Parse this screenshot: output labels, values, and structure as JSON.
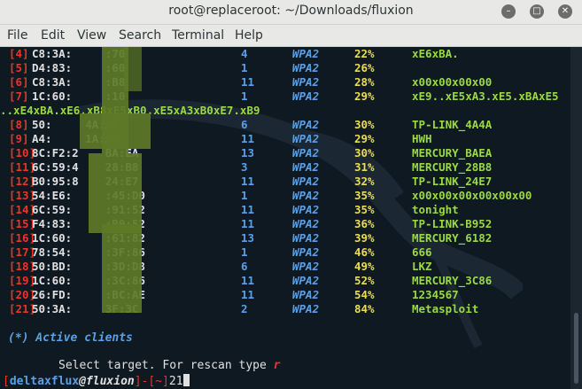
{
  "window": {
    "title": "root@replaceroot: ~/Downloads/fluxion",
    "buttons": [
      "minimize",
      "maximize",
      "close"
    ]
  },
  "menu": [
    "File",
    "Edit",
    "View",
    "Search",
    "Terminal",
    "Help"
  ],
  "networks": [
    {
      "idx": "4",
      "bssid": "C8:3A:     :70",
      "ch": "4",
      "enc": "WPA2",
      "pwr": "22%",
      "essid": "xE6xBA."
    },
    {
      "idx": "5",
      "bssid": "D4:83:     :60",
      "ch": "1",
      "enc": "WPA2",
      "pwr": "26%",
      "essid": ""
    },
    {
      "idx": "6",
      "bssid": "C8:3A:     :B8",
      "ch": "11",
      "enc": "WPA2",
      "pwr": "28%",
      "essid": "x00x00x00x00"
    },
    {
      "idx": "7",
      "bssid": "1C:60:     :10",
      "ch": "1",
      "enc": "WPA2",
      "pwr": "29%",
      "essid": "xE9..xE5xA3.xE5.xBAxE5"
    },
    {
      "idx": "8",
      "bssid": "50:     4A:4A",
      "ch": "6",
      "enc": "WPA2",
      "pwr": "30%",
      "essid": "TP-LINK_4A4A"
    },
    {
      "idx": "9",
      "bssid": "A4:     1A:57",
      "ch": "11",
      "enc": "WPA2",
      "pwr": "29%",
      "essid": "HWH"
    },
    {
      "idx": "10",
      "bssid": "8C:F2:2    BA:EA",
      "ch": "13",
      "enc": "WPA2",
      "pwr": "30%",
      "essid": "MERCURY_BAEA"
    },
    {
      "idx": "11",
      "bssid": "6C:59:4    28:B8",
      "ch": "3",
      "enc": "WPA2",
      "pwr": "31%",
      "essid": "MERCURY_28B8"
    },
    {
      "idx": "12",
      "bssid": "B0:95:8    24:E7",
      "ch": "11",
      "enc": "WPA2",
      "pwr": "32%",
      "essid": "TP-LINK_24E7"
    },
    {
      "idx": "13",
      "bssid": "54:E6:     :45:D0",
      "ch": "1",
      "enc": "WPA2",
      "pwr": "35%",
      "essid": "x00x00x00x00x00x00"
    },
    {
      "idx": "14",
      "bssid": "6C:59:     :91:52",
      "ch": "11",
      "enc": "WPA2",
      "pwr": "35%",
      "essid": "tonight"
    },
    {
      "idx": "15",
      "bssid": "F4:83:     :B9:52",
      "ch": "11",
      "enc": "WPA2",
      "pwr": "36%",
      "essid": "TP-LINK-B952"
    },
    {
      "idx": "16",
      "bssid": "1C:60:     :61:82",
      "ch": "13",
      "enc": "WPA2",
      "pwr": "39%",
      "essid": "MERCURY_6182"
    },
    {
      "idx": "17",
      "bssid": "78:54:     :3F:86",
      "ch": "1",
      "enc": "WPA2",
      "pwr": "46%",
      "essid": "666"
    },
    {
      "idx": "18",
      "bssid": "50:BD:     :3D:D8",
      "ch": "6",
      "enc": "WPA2",
      "pwr": "49%",
      "essid": "LKZ"
    },
    {
      "idx": "19",
      "bssid": "1C:60:     :3C:86",
      "ch": "11",
      "enc": "WPA2",
      "pwr": "52%",
      "essid": "MERCURY_3C86"
    },
    {
      "idx": "20",
      "bssid": "26:FD:     :BC:AE",
      "ch": "11",
      "enc": "WPA2",
      "pwr": "54%",
      "essid": "1234567"
    },
    {
      "idx": "21",
      "bssid": "50:3A:     3F:3C",
      "ch": "2",
      "enc": "WPA2",
      "pwr": "84%",
      "essid": "Metasploit"
    }
  ],
  "wrap_line": "..xE4xBA.xE6.xB8xE5xB0.xE5xA3xB0xE7.xB9",
  "active_clients": "(*) Active clients",
  "prompt": {
    "text": "Select target. For rescan type ",
    "rescan_key": "r"
  },
  "shell": {
    "open": "[",
    "user": "deltaxflux",
    "at": "@",
    "host": "fluxion",
    "mid": "]-[",
    "dir": "~",
    "close": "]",
    "typed": "21"
  },
  "colors": {
    "background": "#0f1922",
    "index": "#e8342b",
    "channel": "#5aa0e6",
    "power": "#eadf50",
    "essid": "#9ad845"
  }
}
